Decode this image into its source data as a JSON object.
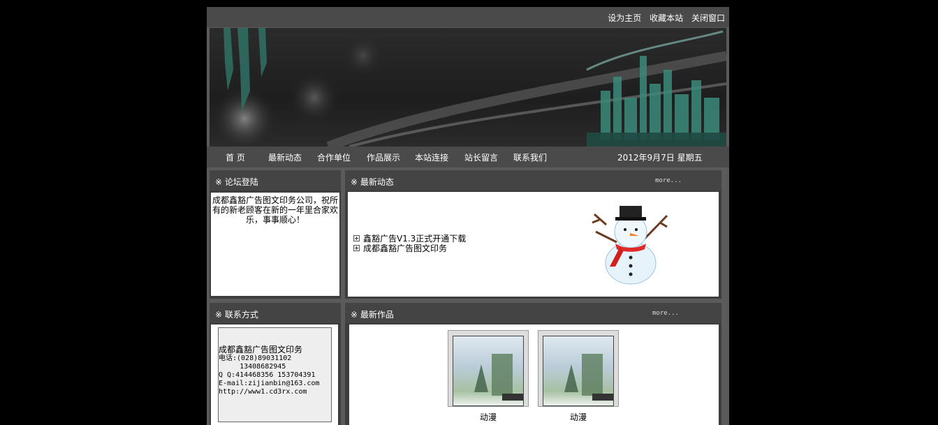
{
  "top_links": [
    "设为主页",
    "收藏本站",
    "关闭窗口"
  ],
  "nav": {
    "items": [
      "首 页",
      "最新动态",
      "合作单位",
      "作品展示",
      "本站连接",
      "站长留言",
      "联系我们"
    ],
    "date": "2012年9月7日 星期五"
  },
  "login": {
    "title": "※ 论坛登陆",
    "text": "成都鑫豁广告图文印务公司，祝所有的新老顾客在新的一年里合家欢乐，事事顺心！"
  },
  "news": {
    "title": "※ 最新动态",
    "more": "more...",
    "items": [
      "鑫豁广告V1.3正式开通下载",
      "成都鑫豁广告图文印务"
    ]
  },
  "contact": {
    "title": "※ 联系方式",
    "lines": [
      "成都鑫豁广告图文印务",
      "电话:(028)89031102",
      "     13408682945",
      "Q Q:414468356 153704391",
      "E-mail:zijianbin@163.com",
      "http://www1.cd3rx.com"
    ]
  },
  "works": {
    "title": "※ 最新作品",
    "more": "more...",
    "items": [
      {
        "caption": "动漫",
        "icon": "anime-thumbnail"
      },
      {
        "caption": "动漫",
        "icon": "anime-thumbnail"
      }
    ]
  },
  "colors": {
    "page_background": "#000000",
    "frame": "#5b5b5b",
    "header_bar": "#4a4a4a",
    "panel_head": "#444444",
    "text_light": "#ffffff"
  }
}
